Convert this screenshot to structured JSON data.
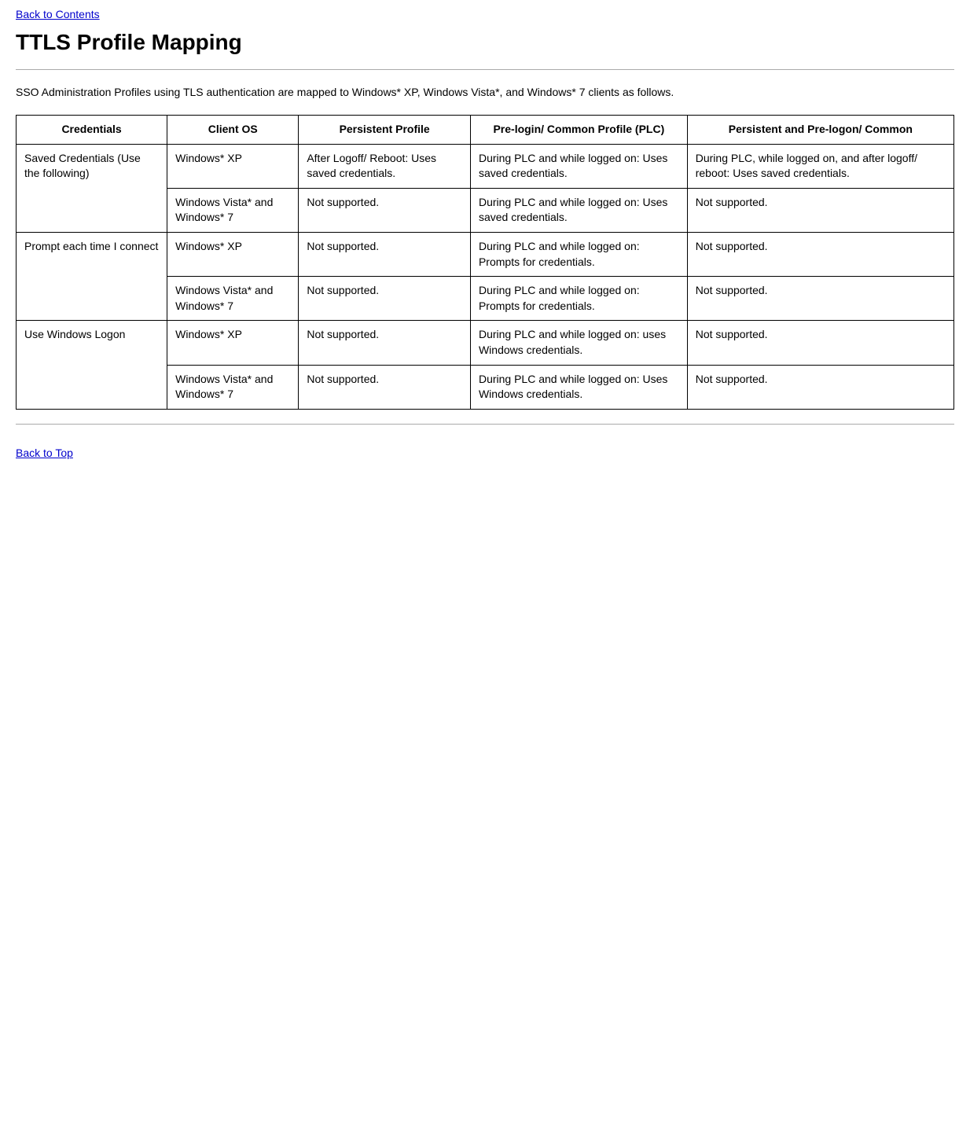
{
  "nav": {
    "back_to_contents": "Back to Contents",
    "back_to_top": "Back to Top"
  },
  "page": {
    "title": "TTLS Profile Mapping",
    "intro": "SSO Administration Profiles using TLS authentication are mapped to Windows* XP, Windows Vista*, and Windows* 7 clients as follows."
  },
  "table": {
    "headers": [
      "Credentials",
      "Client OS",
      "Persistent Profile",
      "Pre-login/\nCommon Profile (PLC)",
      "Persistent and Pre-logon/\nCommon"
    ],
    "rows": [
      {
        "credentials": "Saved Credentials (Use the following)",
        "os": "Windows* XP",
        "persistent": "After Logoff/ Reboot: Uses saved credentials.",
        "prelogin": "During PLC and while logged on: Uses saved credentials.",
        "persistent_pre": "During PLC, while logged on, and after logoff/ reboot: Uses saved credentials."
      },
      {
        "credentials": "",
        "os": "Windows Vista* and Windows* 7",
        "persistent": "Not supported.",
        "prelogin": "During PLC and while logged on: Uses saved credentials.",
        "persistent_pre": "Not supported."
      },
      {
        "credentials": "Prompt each time I connect",
        "os": "Windows* XP",
        "persistent": "Not supported.",
        "prelogin": "During PLC and while logged on: Prompts for credentials.",
        "persistent_pre": "Not supported."
      },
      {
        "credentials": "",
        "os": "Windows Vista* and Windows* 7",
        "persistent": "Not supported.",
        "prelogin": "During PLC and while logged on: Prompts for credentials.",
        "persistent_pre": "Not supported."
      },
      {
        "credentials": "Use Windows Logon",
        "os": "Windows* XP",
        "persistent": "Not supported.",
        "prelogin": "During PLC and while logged on: uses Windows credentials.",
        "persistent_pre": "Not supported."
      },
      {
        "credentials": "",
        "os": "Windows Vista* and Windows* 7",
        "persistent": "Not supported.",
        "prelogin": "During PLC and while logged on: Uses Windows credentials.",
        "persistent_pre": "Not supported."
      }
    ]
  }
}
